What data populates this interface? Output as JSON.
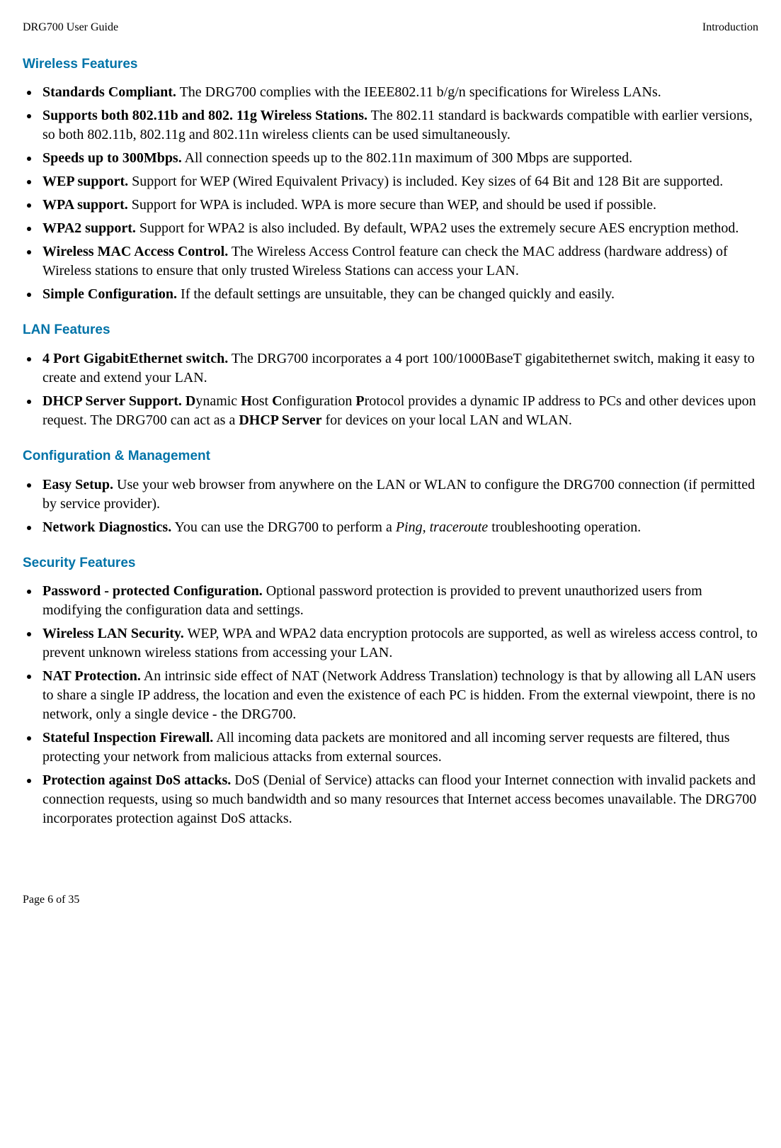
{
  "header": {
    "left": "DRG700 User Guide",
    "right": "Introduction"
  },
  "sections": {
    "wireless": {
      "heading": "Wireless Features",
      "items": [
        {
          "bold": "Standards Compliant.",
          "text": " The DRG700 complies with the IEEE802.11 b/g/n specifications for Wireless LANs."
        },
        {
          "bold": "Supports both 802.11b and 802. 11g Wireless Stations.",
          "text": " The 802.11 standard is backwards compatible with earlier versions, so both 802.11b, 802.11g and 802.11n wireless clients can be used simultaneously."
        },
        {
          "bold": "Speeds up to 300Mbps.",
          "text": " All connection speeds up to the 802.11n maximum of 300 Mbps are supported."
        },
        {
          "bold": "WEP support.",
          "text": " Support for WEP (Wired Equivalent Privacy) is included. Key sizes of 64 Bit and 128 Bit are supported."
        },
        {
          "bold": "WPA support.",
          "text": " Support for WPA is included. WPA is more secure than WEP, and should be used if possible."
        },
        {
          "bold": "WPA2 support.",
          "text": " Support for WPA2 is also included. By default, WPA2 uses the extremely secure AES encryption method."
        },
        {
          "bold": "Wireless MAC Access Control.",
          "text": " The Wireless Access Control feature can check the MAC address (hardware address) of Wireless stations to ensure that only trusted Wireless Stations can access your LAN."
        },
        {
          "bold": "Simple Configuration.",
          "text": " If the default settings are unsuitable, they can be changed quickly and easily."
        }
      ]
    },
    "lan": {
      "heading": "LAN Features",
      "item1": {
        "bold": "4 Port GigabitEthernet switch.",
        "text": " The DRG700 incorporates a 4 port 100/1000BaseT gigabitethernet switch, making it easy to create and extend your LAN."
      },
      "item2": {
        "bold1": "DHCP Server Support. D",
        "t1": "ynamic ",
        "bold2": "H",
        "t2": "ost ",
        "bold3": "C",
        "t3": "onfiguration ",
        "bold4": "P",
        "t4": "rotocol provides a dynamic IP address to PCs and other devices upon request. The DRG700 can act as a ",
        "bold5": "DHCP Server",
        "t5": " for devices on your local LAN and WLAN."
      }
    },
    "config": {
      "heading": "Configuration & Management",
      "item1": {
        "bold": "Easy Setup.",
        "text": " Use your web browser from anywhere on the LAN or WLAN to configure the DRG700 connection (if permitted by service provider)."
      },
      "item2": {
        "bold": "Network Diagnostics.",
        "t1": " You can use the DRG700 to perform a ",
        "italic": "Ping, traceroute",
        "t2": " troubleshooting operation."
      }
    },
    "security": {
      "heading": "Security Features",
      "items": [
        {
          "bold": "Password - protected Configuration.",
          "text": " Optional password protection is provided to prevent unauthorized users from modifying the configuration data and settings."
        },
        {
          "bold": "Wireless LAN Security.",
          "text": " WEP, WPA and WPA2 data encryption protocols are supported, as well as wireless access control, to prevent unknown wireless stations from accessing your LAN."
        },
        {
          "bold": "NAT Protection.",
          "text": " An intrinsic side effect of NAT (Network Address Translation) technology is that by allowing all LAN users to share a single IP address, the location and even the existence of each PC is hidden. From the external viewpoint, there is no network, only a single device - the DRG700."
        },
        {
          "bold": "Stateful Inspection Firewall.",
          "text": " All incoming data packets are monitored and all incoming server requests are filtered, thus protecting your network from malicious attacks from external sources."
        },
        {
          "bold": "Protection against DoS attacks.",
          "text": " DoS (Denial of Service) attacks can flood your Internet connection with invalid packets and connection requests, using so much bandwidth and so many resources that Internet access becomes unavailable. The DRG700 incorporates protection against DoS attacks."
        }
      ]
    }
  },
  "footer": "Page 6 of 35"
}
